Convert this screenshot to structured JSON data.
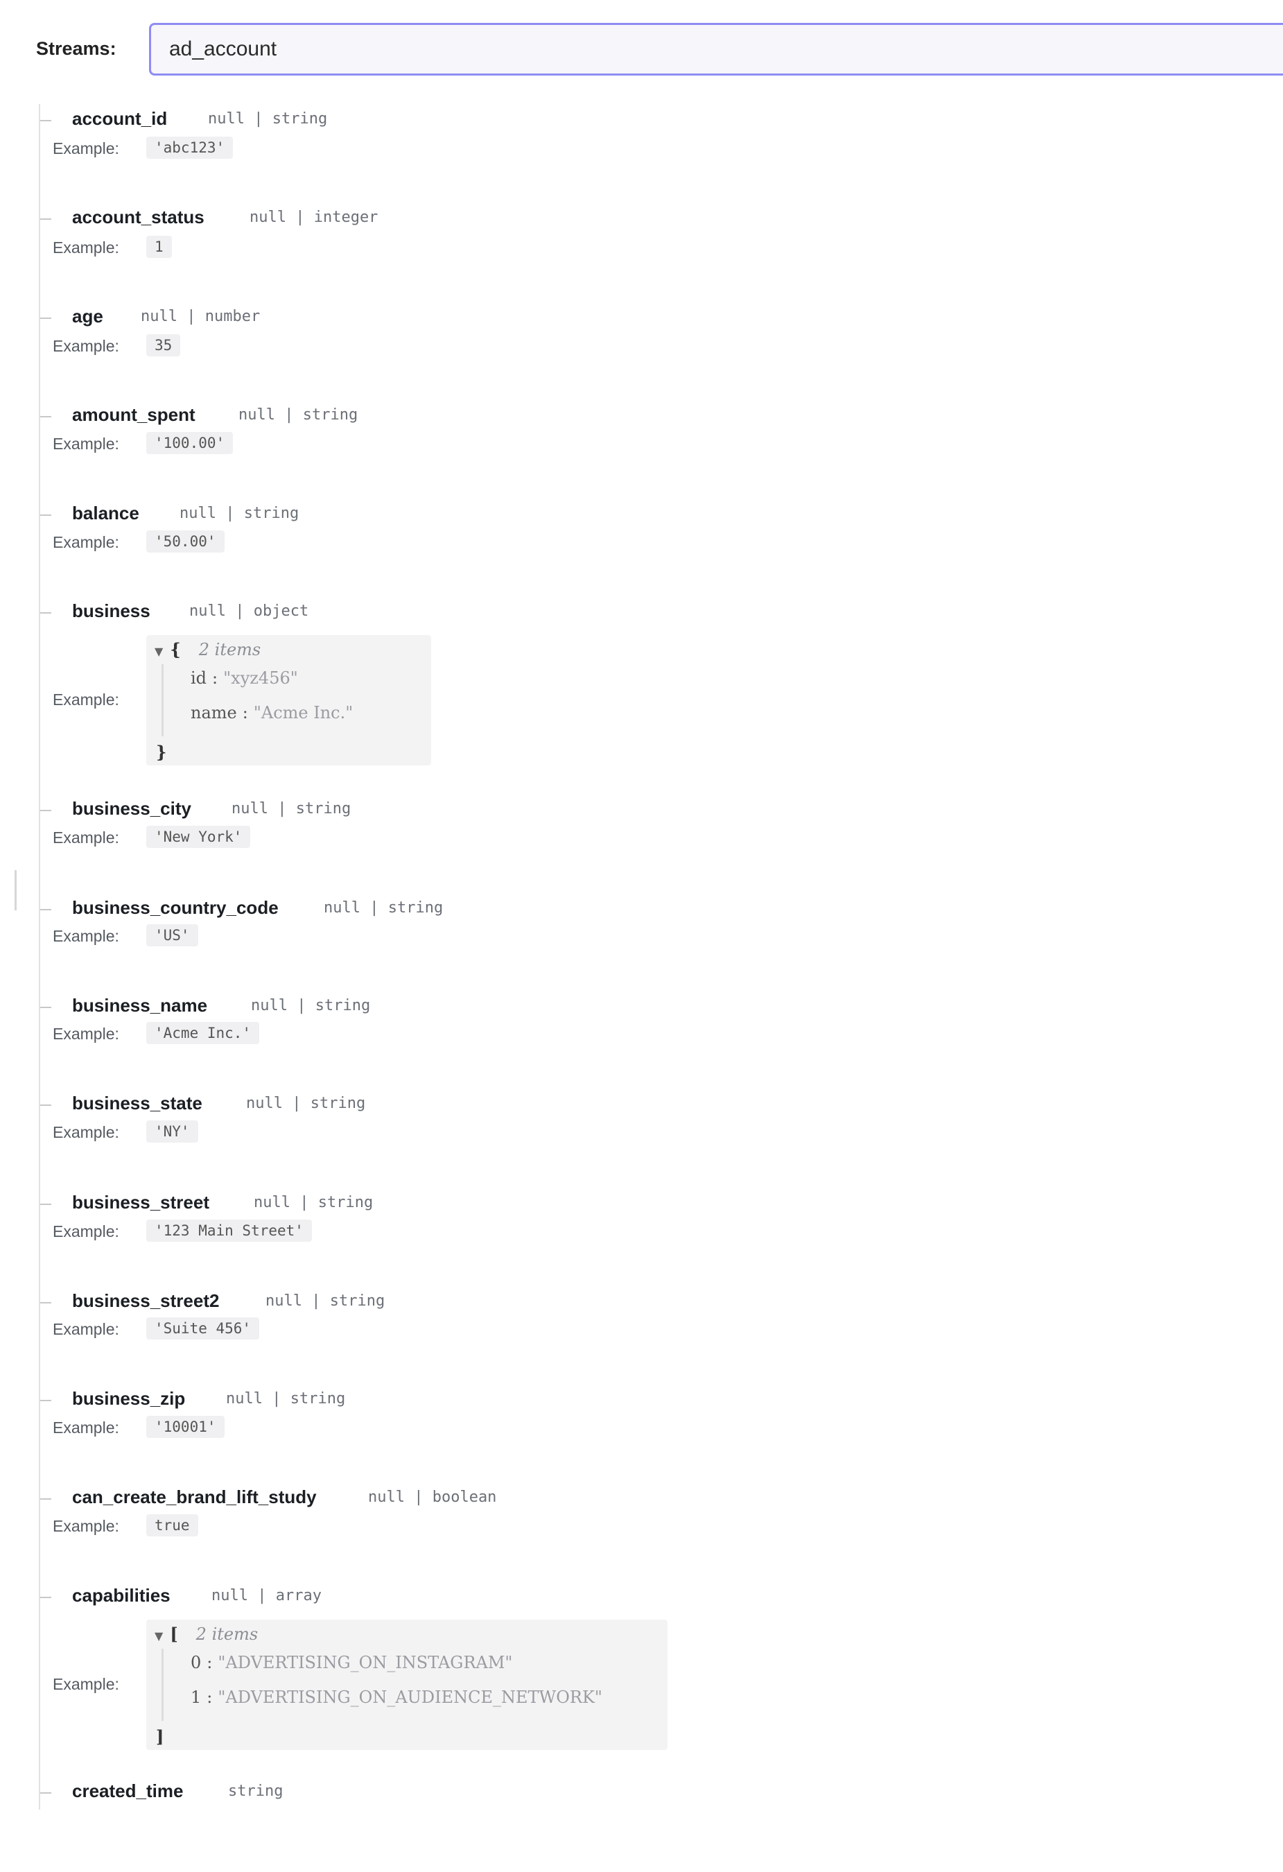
{
  "header": {
    "streams_label": "Streams:",
    "streams_value": "ad_account"
  },
  "example_label": "Example:",
  "fields": [
    {
      "name": "account_id",
      "type": "null | string",
      "example": "'abc123'"
    },
    {
      "name": "account_status",
      "type": "null | integer",
      "example": "1"
    },
    {
      "name": "age",
      "type": "null | number",
      "example": "35"
    },
    {
      "name": "amount_spent",
      "type": "null | string",
      "example": "'100.00'"
    },
    {
      "name": "balance",
      "type": "null | string",
      "example": "'50.00'"
    },
    {
      "name": "business",
      "type": "null | object",
      "example_object": {
        "open": "{",
        "close": "}",
        "count": "2 items",
        "entries": [
          {
            "key": "id",
            "value": "\"xyz456\""
          },
          {
            "key": "name",
            "value": "\"Acme Inc.\""
          }
        ]
      }
    },
    {
      "name": "business_city",
      "type": "null | string",
      "example": "'New York'"
    },
    {
      "name": "business_country_code",
      "type": "null | string",
      "example": "'US'"
    },
    {
      "name": "business_name",
      "type": "null | string",
      "example": "'Acme Inc.'"
    },
    {
      "name": "business_state",
      "type": "null | string",
      "example": "'NY'"
    },
    {
      "name": "business_street",
      "type": "null | string",
      "example": "'123 Main Street'"
    },
    {
      "name": "business_street2",
      "type": "null | string",
      "example": "'Suite 456'"
    },
    {
      "name": "business_zip",
      "type": "null | string",
      "example": "'10001'"
    },
    {
      "name": "can_create_brand_lift_study",
      "type": "null | boolean",
      "example": "true"
    },
    {
      "name": "capabilities",
      "type": "null | array",
      "example_object": {
        "open": "[",
        "close": "]",
        "count": "2 items",
        "entries": [
          {
            "key": "0",
            "value": "\"ADVERTISING_ON_INSTAGRAM\""
          },
          {
            "key": "1",
            "value": "\"ADVERTISING_ON_AUDIENCE_NETWORK\""
          }
        ]
      }
    },
    {
      "name": "created_time",
      "type": "string"
    }
  ]
}
